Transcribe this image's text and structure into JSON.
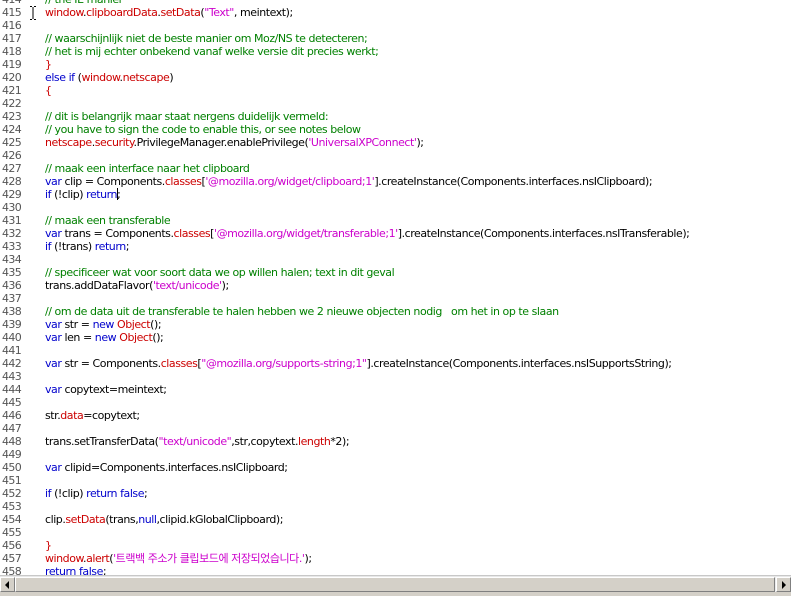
{
  "colors": {
    "default": "#000000",
    "keyword": "#0000cc",
    "comment": "#008000",
    "string": "#cc00cc",
    "red": "#cc0000",
    "object": "#000080"
  },
  "editor": {
    "lines": [
      {
        "n": "414",
        "tokens": [
          [
            "comment",
            "// the IE manier"
          ]
        ]
      },
      {
        "n": "415",
        "tokens": [
          [
            "red",
            "window"
          ],
          [
            "default",
            "."
          ],
          [
            "red",
            "clipboardData"
          ],
          [
            "default",
            "."
          ],
          [
            "red",
            "setData"
          ],
          [
            "default",
            "("
          ],
          [
            "string",
            "\"Text\""
          ],
          [
            "default",
            ", meintext);"
          ]
        ]
      },
      {
        "n": "416",
        "tokens": []
      },
      {
        "n": "417",
        "tokens": [
          [
            "comment",
            "// waarschijnlijk niet de beste manier om Moz/NS te detecteren;"
          ]
        ]
      },
      {
        "n": "418",
        "tokens": [
          [
            "comment",
            "// het is mij echter onbekend vanaf welke versie dit precies werkt;"
          ]
        ]
      },
      {
        "n": "419",
        "tokens": [
          [
            "red",
            "}"
          ]
        ]
      },
      {
        "n": "420",
        "tokens": [
          [
            "keyword",
            "else if"
          ],
          [
            "default",
            " ("
          ],
          [
            "red",
            "window"
          ],
          [
            "default",
            "."
          ],
          [
            "red",
            "netscape"
          ],
          [
            "default",
            ")"
          ]
        ]
      },
      {
        "n": "421",
        "tokens": [
          [
            "red",
            "{"
          ]
        ]
      },
      {
        "n": "422",
        "tokens": []
      },
      {
        "n": "423",
        "tokens": [
          [
            "comment",
            "// dit is belangrijk maar staat nergens duidelijk vermeld:"
          ]
        ]
      },
      {
        "n": "424",
        "tokens": [
          [
            "comment",
            "// you have to sign the code to enable this, or see notes below"
          ]
        ]
      },
      {
        "n": "425",
        "tokens": [
          [
            "red",
            "netscape"
          ],
          [
            "default",
            "."
          ],
          [
            "red",
            "security"
          ],
          [
            "default",
            ".PrivilegeManager.enablePrivilege("
          ],
          [
            "string",
            "'UniversalXPConnect'"
          ],
          [
            "default",
            ");"
          ]
        ]
      },
      {
        "n": "426",
        "tokens": []
      },
      {
        "n": "427",
        "tokens": [
          [
            "comment",
            "// maak een interface naar het clipboard"
          ]
        ]
      },
      {
        "n": "428",
        "tokens": [
          [
            "keyword",
            "var"
          ],
          [
            "default",
            " clip = Components."
          ],
          [
            "red",
            "classes"
          ],
          [
            "default",
            "["
          ],
          [
            "string",
            "'@mozilla.org/widget/clipboard;1'"
          ],
          [
            "default",
            "].createInstance(Components.interfaces.nsIClipboard);"
          ]
        ]
      },
      {
        "n": "429",
        "tokens": [
          [
            "keyword",
            "if"
          ],
          [
            "default",
            " (!clip) "
          ],
          [
            "keyword",
            "return"
          ],
          [
            "default",
            ";"
          ]
        ]
      },
      {
        "n": "430",
        "tokens": []
      },
      {
        "n": "431",
        "tokens": [
          [
            "comment",
            "// maak een transferable"
          ]
        ]
      },
      {
        "n": "432",
        "tokens": [
          [
            "keyword",
            "var"
          ],
          [
            "default",
            " trans = Components."
          ],
          [
            "red",
            "classes"
          ],
          [
            "default",
            "["
          ],
          [
            "string",
            "'@mozilla.org/widget/transferable;1'"
          ],
          [
            "default",
            "].createInstance(Components.interfaces.nsITransferable);"
          ]
        ]
      },
      {
        "n": "433",
        "tokens": [
          [
            "keyword",
            "if"
          ],
          [
            "default",
            " (!trans) "
          ],
          [
            "keyword",
            "return"
          ],
          [
            "default",
            ";"
          ]
        ]
      },
      {
        "n": "434",
        "tokens": []
      },
      {
        "n": "435",
        "tokens": [
          [
            "comment",
            "// specificeer wat voor soort data we op willen halen; text in dit geval"
          ]
        ]
      },
      {
        "n": "436",
        "tokens": [
          [
            "default",
            "trans.addDataFlavor("
          ],
          [
            "string",
            "'text/unicode'"
          ],
          [
            "default",
            ");"
          ]
        ]
      },
      {
        "n": "437",
        "tokens": []
      },
      {
        "n": "438",
        "tokens": [
          [
            "comment",
            "// om de data uit de transferable te halen hebben we 2 nieuwe objecten nodig   om het in op te slaan"
          ]
        ]
      },
      {
        "n": "439",
        "tokens": [
          [
            "keyword",
            "var"
          ],
          [
            "default",
            " str = "
          ],
          [
            "keyword",
            "new"
          ],
          [
            "default",
            " "
          ],
          [
            "red",
            "Object"
          ],
          [
            "default",
            "();"
          ]
        ]
      },
      {
        "n": "440",
        "tokens": [
          [
            "keyword",
            "var"
          ],
          [
            "default",
            " len = "
          ],
          [
            "keyword",
            "new"
          ],
          [
            "default",
            " "
          ],
          [
            "red",
            "Object"
          ],
          [
            "default",
            "();"
          ]
        ]
      },
      {
        "n": "441",
        "tokens": []
      },
      {
        "n": "442",
        "tokens": [
          [
            "keyword",
            "var"
          ],
          [
            "default",
            " str = Components."
          ],
          [
            "red",
            "classes"
          ],
          [
            "default",
            "["
          ],
          [
            "string",
            "\"@mozilla.org/supports-string;1\""
          ],
          [
            "default",
            "].createInstance(Components.interfaces.nsISupportsString);"
          ]
        ]
      },
      {
        "n": "443",
        "tokens": []
      },
      {
        "n": "444",
        "tokens": [
          [
            "keyword",
            "var"
          ],
          [
            "default",
            " copytext=meintext;"
          ]
        ]
      },
      {
        "n": "445",
        "tokens": []
      },
      {
        "n": "446",
        "tokens": [
          [
            "default",
            "str."
          ],
          [
            "red",
            "data"
          ],
          [
            "default",
            "=copytext;"
          ]
        ]
      },
      {
        "n": "447",
        "tokens": []
      },
      {
        "n": "448",
        "tokens": [
          [
            "default",
            "trans.setTransferData("
          ],
          [
            "string",
            "\"text/unicode\""
          ],
          [
            "default",
            ",str,copytext."
          ],
          [
            "red",
            "length"
          ],
          [
            "default",
            "*2);"
          ]
        ]
      },
      {
        "n": "449",
        "tokens": []
      },
      {
        "n": "450",
        "tokens": [
          [
            "keyword",
            "var"
          ],
          [
            "default",
            " clipid=Components.interfaces.nsIClipboard;"
          ]
        ]
      },
      {
        "n": "451",
        "tokens": []
      },
      {
        "n": "452",
        "tokens": [
          [
            "keyword",
            "if"
          ],
          [
            "default",
            " (!clip) "
          ],
          [
            "keyword",
            "return"
          ],
          [
            "default",
            " "
          ],
          [
            "keyword",
            "false"
          ],
          [
            "default",
            ";"
          ]
        ]
      },
      {
        "n": "453",
        "tokens": []
      },
      {
        "n": "454",
        "tokens": [
          [
            "default",
            "clip."
          ],
          [
            "red",
            "setData"
          ],
          [
            "default",
            "(trans,"
          ],
          [
            "keyword",
            "null"
          ],
          [
            "default",
            ",clipid.kGlobalClipboard);"
          ]
        ]
      },
      {
        "n": "455",
        "tokens": []
      },
      {
        "n": "456",
        "tokens": [
          [
            "red",
            "}"
          ]
        ]
      },
      {
        "n": "457",
        "tokens": [
          [
            "red",
            "window"
          ],
          [
            "default",
            "."
          ],
          [
            "red",
            "alert"
          ],
          [
            "default",
            "("
          ],
          [
            "string",
            "'트랙백 주소가 클립보드에 저장되었습니다.'"
          ],
          [
            "default",
            ");"
          ]
        ]
      },
      {
        "n": "458",
        "tokens": [
          [
            "keyword",
            "return"
          ],
          [
            "default",
            " "
          ],
          [
            "keyword",
            "false"
          ],
          [
            "default",
            ";"
          ]
        ]
      }
    ]
  }
}
